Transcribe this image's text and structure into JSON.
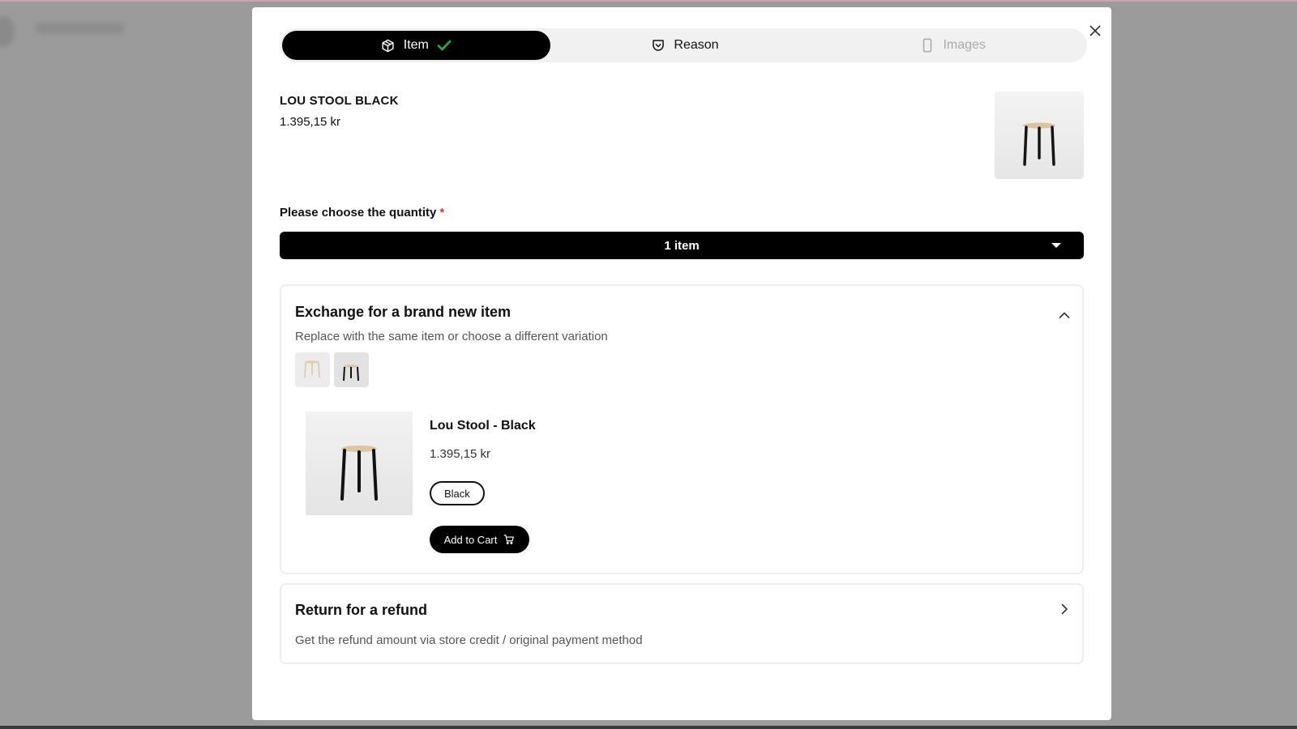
{
  "steps": [
    {
      "label": "Item",
      "state": "complete"
    },
    {
      "label": "Reason",
      "state": "current"
    },
    {
      "label": "Images",
      "state": "pending"
    }
  ],
  "product": {
    "name": "LOU STOOL BLACK",
    "price": "1.395,15 kr"
  },
  "quantity": {
    "label": "Please choose the quantity",
    "required_mark": "*",
    "selected": "1 item"
  },
  "exchange": {
    "title": "Exchange for a brand new item",
    "subtitle": "Replace with the same item or choose a different variation",
    "variant": {
      "name": "Lou Stool - Black",
      "price": "1.395,15 kr",
      "color_option": "Black",
      "add_to_cart_label": "Add to Cart"
    }
  },
  "refund": {
    "title": "Return for a refund",
    "subtitle": "Get the refund amount via store credit / original payment method"
  },
  "colors": {
    "accent": "#000000",
    "check": "#2e9e4f",
    "required": "#d23b3b",
    "backdrop": "#9b9b9b"
  }
}
